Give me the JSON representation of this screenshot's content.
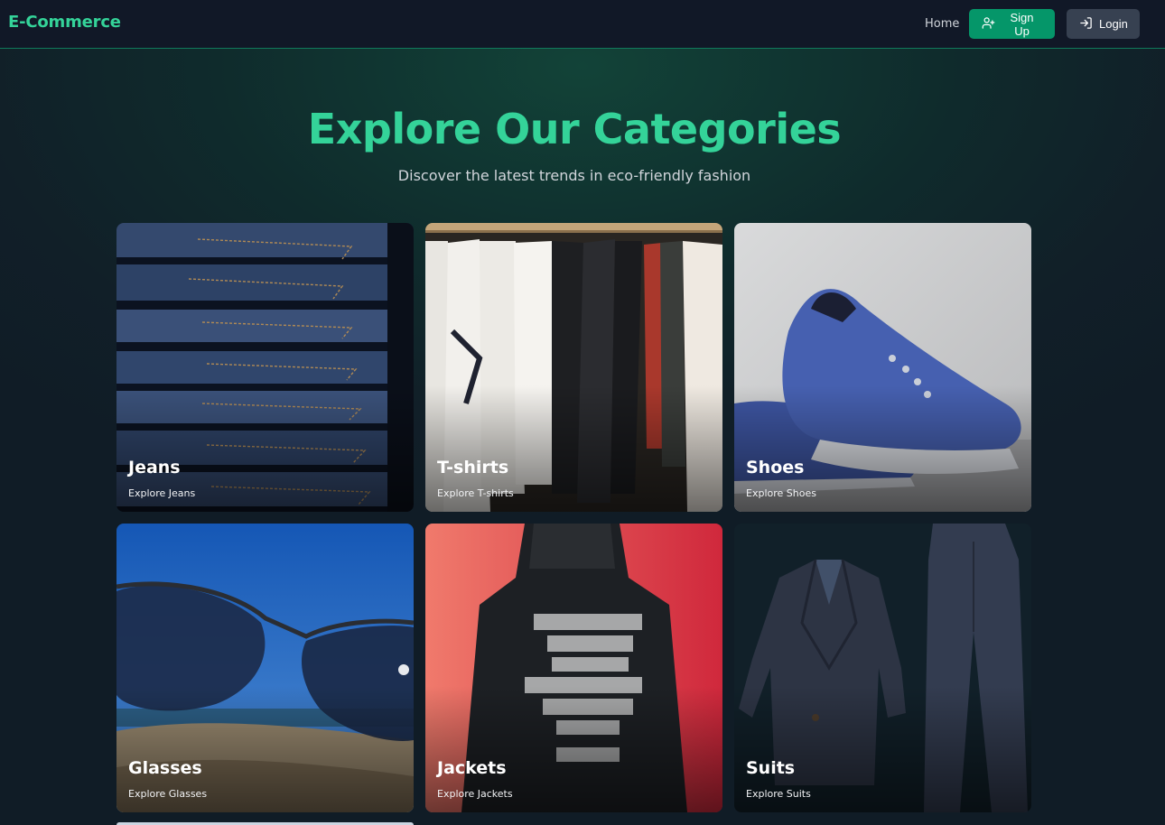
{
  "nav": {
    "brand": "E-Commerce",
    "home": "Home",
    "signup": "Sign Up",
    "login": "Login"
  },
  "hero": {
    "title": "Explore Our Categories",
    "subtitle": "Discover the latest trends in eco-friendly fashion"
  },
  "categories": [
    {
      "name": "Jeans",
      "link": "Explore Jeans"
    },
    {
      "name": "T-shirts",
      "link": "Explore T-shirts"
    },
    {
      "name": "Shoes",
      "link": "Explore Shoes"
    },
    {
      "name": "Glasses",
      "link": "Explore Glasses"
    },
    {
      "name": "Jackets",
      "link": "Explore Jackets"
    },
    {
      "name": "Suits",
      "link": "Explore Suits"
    }
  ],
  "colors": {
    "accent": "#34d399",
    "navbar_bg": "#111827",
    "signup_bg": "#059669",
    "login_bg": "#374151"
  },
  "icons": {
    "signup": "user-plus-icon",
    "login": "log-in-icon"
  }
}
